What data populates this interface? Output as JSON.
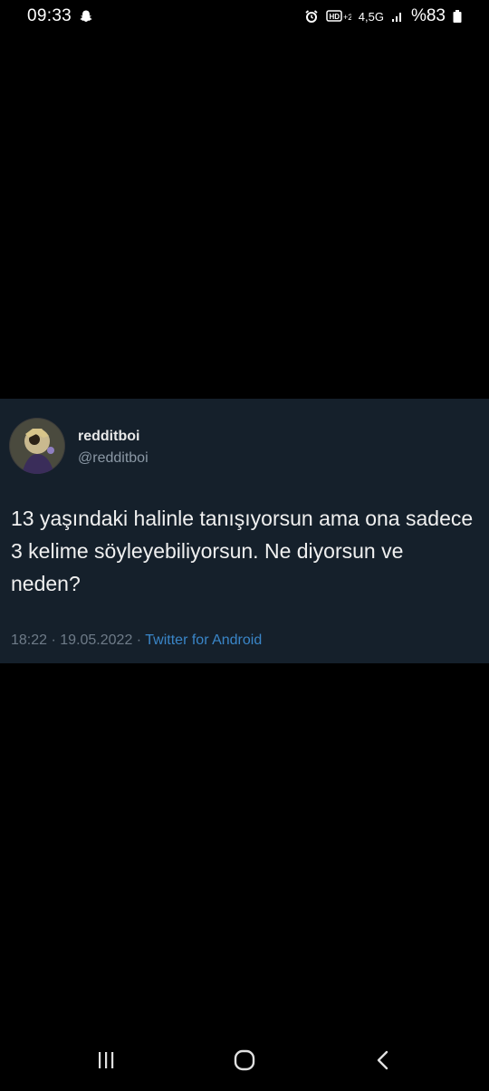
{
  "status_bar": {
    "time": "09:33",
    "battery_text": "%83",
    "network_label": "4,5G",
    "icons": [
      "snapchat-icon",
      "alarm-icon",
      "hd-volte-icon",
      "signal-icon",
      "battery-icon"
    ]
  },
  "tweet": {
    "display_name": "redditboi",
    "handle": "@redditboi",
    "text": "13 yaşındaki halinle tanışıyorsun ama ona sadece 3 kelime söyleyebiliyorsun. Ne diyorsun ve neden?",
    "time": "18:22",
    "date": "19.05.2022",
    "separator": " · ",
    "source": "Twitter for Android",
    "background_color": "#15202b",
    "source_color": "#3a86c8"
  },
  "nav_bar": {
    "icons": [
      "recent-apps-icon",
      "home-icon",
      "back-icon"
    ]
  }
}
